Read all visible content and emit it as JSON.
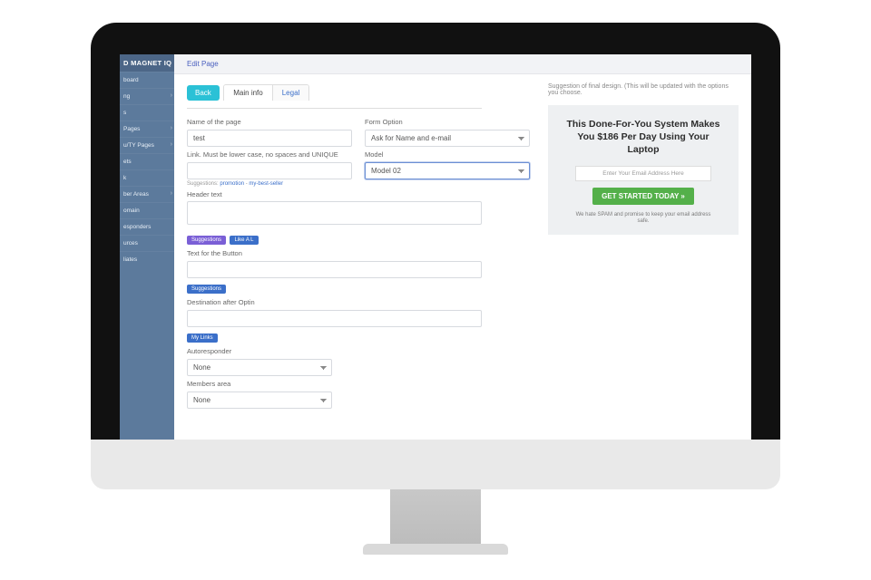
{
  "brand": "D MAGNET IQ",
  "sidebar": {
    "items": [
      {
        "label": "board"
      },
      {
        "label": "ng",
        "expandable": true
      },
      {
        "label": "s"
      },
      {
        "label": "Pages",
        "expandable": true
      },
      {
        "label": "u/TY Pages",
        "expandable": true
      },
      {
        "label": "ets"
      },
      {
        "label": "k"
      },
      {
        "label": "ber Areas",
        "expandable": true
      },
      {
        "label": "omain"
      },
      {
        "label": "esponders"
      },
      {
        "label": "urces"
      },
      {
        "label": "liates"
      }
    ]
  },
  "breadcrumb": "Edit Page",
  "back_label": "Back",
  "preview_hint": "Suggestion of final design. (This will be updated with the options you choose.",
  "tabs": [
    {
      "label": "Main info",
      "active": true
    },
    {
      "label": "Legal",
      "active": false
    }
  ],
  "form": {
    "name_label": "Name of the page",
    "name_value": "test",
    "formopt_label": "Form Option",
    "formopt_value": "Ask for Name and e-mail",
    "link_label": "Link. Must be lower case, no spaces and UNIQUE",
    "link_value": "",
    "model_label": "Model",
    "model_value": "Model 02",
    "suggestions_prefix": "Suggestions:",
    "suggestion_1": "promotion",
    "suggestion_sep": " - ",
    "suggestion_2": "my-best-seller",
    "header_label": "Header text",
    "header_value": "",
    "badge_suggestions": "Suggestions",
    "badge_likea": "Like A L",
    "button_text_label": "Text for the Button",
    "button_text_value": "",
    "dest_label": "Destination after Optin",
    "dest_value": "",
    "badge_mylinks": "My Links",
    "autoresp_label": "Autoresponder",
    "autoresp_value": "None",
    "members_label": "Members area",
    "members_value": "None"
  },
  "preview": {
    "headline": "This Done-For-You System Makes You $186 Per Day Using Your Laptop",
    "email_placeholder": "Enter Your Email Address Here",
    "cta": "GET STARTED TODAY »",
    "spam": "We hate SPAM and promise to keep your email address safe."
  }
}
